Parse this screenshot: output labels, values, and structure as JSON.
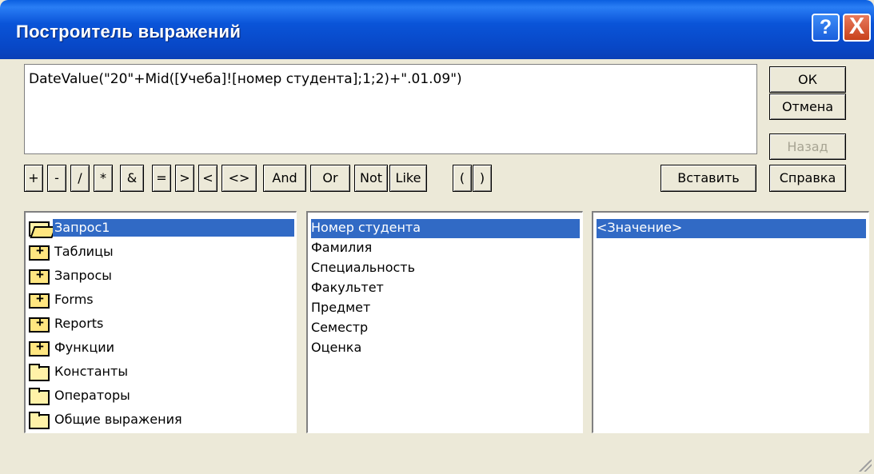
{
  "window": {
    "title": "Построитель выражений"
  },
  "title_buttons": {
    "help": "?",
    "close": "X"
  },
  "expression": "DateValue(\"20\"+Mid([Учеба]![номер студента];1;2)+\".01.09\")",
  "side_buttons": {
    "ok": "ОК",
    "cancel": "Отмена",
    "back": "Назад",
    "help": "Справка"
  },
  "operators": [
    "+",
    "-",
    "/",
    "*",
    "&",
    "=",
    ">",
    "<",
    "<>",
    "And",
    "Or",
    "Not",
    "Like",
    "(",
    ")"
  ],
  "insert_button": "Вставить",
  "folders": [
    {
      "label": "Запрос1",
      "icon": "open-folder-icon",
      "selected": true
    },
    {
      "label": "Таблицы",
      "icon": "plus-folder-icon"
    },
    {
      "label": "Запросы",
      "icon": "plus-folder-icon"
    },
    {
      "label": "Forms",
      "icon": "plus-folder-icon"
    },
    {
      "label": "Reports",
      "icon": "plus-folder-icon"
    },
    {
      "label": "Функции",
      "icon": "plus-folder-icon"
    },
    {
      "label": "Константы",
      "icon": "folder-icon"
    },
    {
      "label": "Операторы",
      "icon": "folder-icon"
    },
    {
      "label": "Общие выражения",
      "icon": "folder-icon"
    }
  ],
  "fields": [
    "Номер студента",
    "Фамилия",
    "Специальность",
    "Факультет",
    "Предмет",
    "Семестр",
    "Оценка"
  ],
  "values": [
    "<Значение>"
  ],
  "colors": {
    "selection": "#316ac5",
    "title_bar": "#0a54d8",
    "face": "#ece9d8"
  }
}
